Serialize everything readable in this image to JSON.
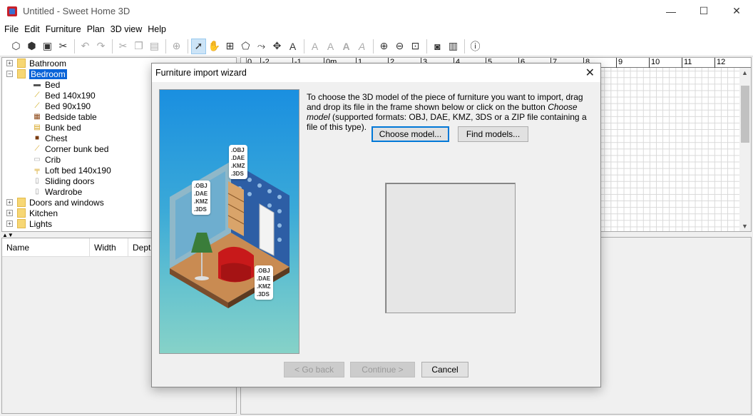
{
  "window": {
    "title": "Untitled - Sweet Home 3D",
    "controls": [
      "—",
      "☐",
      "✕"
    ]
  },
  "menu": [
    "File",
    "Edit",
    "Furniture",
    "Plan",
    "3D view",
    "Help"
  ],
  "tree": {
    "categories": [
      {
        "label": "Bathroom",
        "expanded": false
      },
      {
        "label": "Bedroom",
        "expanded": true,
        "selected": true,
        "items": [
          "Bed",
          "Bed 140x190",
          "Bed 90x190",
          "Bedside table",
          "Bunk bed",
          "Chest",
          "Corner bunk bed",
          "Crib",
          "Loft bed 140x190",
          "Sliding doors",
          "Wardrobe"
        ]
      },
      {
        "label": "Doors and windows",
        "expanded": false
      },
      {
        "label": "Kitchen",
        "expanded": false
      },
      {
        "label": "Lights",
        "expanded": false
      }
    ]
  },
  "table": {
    "columns": [
      "Name",
      "Width",
      "Depth"
    ]
  },
  "ruler": [
    "0",
    "-2",
    "-1",
    "0m",
    "1",
    "2",
    "3",
    "4",
    "5",
    "6",
    "7",
    "8",
    "9",
    "10",
    "11",
    "12"
  ],
  "dialog": {
    "title": "Furniture import wizard",
    "instruction_part1": "To choose the 3D model of the piece of furniture you want to import, drag and drop its file in the frame shown below or click on the button ",
    "instruction_em": "Choose model",
    "instruction_part2": " (supported formats: OBJ, DAE, KMZ, 3DS or a ZIP file containing a file of this type).",
    "choose_model": "Choose model...",
    "find_models": "Find models...",
    "go_back": "< Go back",
    "continue": "Continue >",
    "cancel": "Cancel",
    "formats_tag": ".OBJ\n.DAE\n.KMZ\n.3DS"
  }
}
